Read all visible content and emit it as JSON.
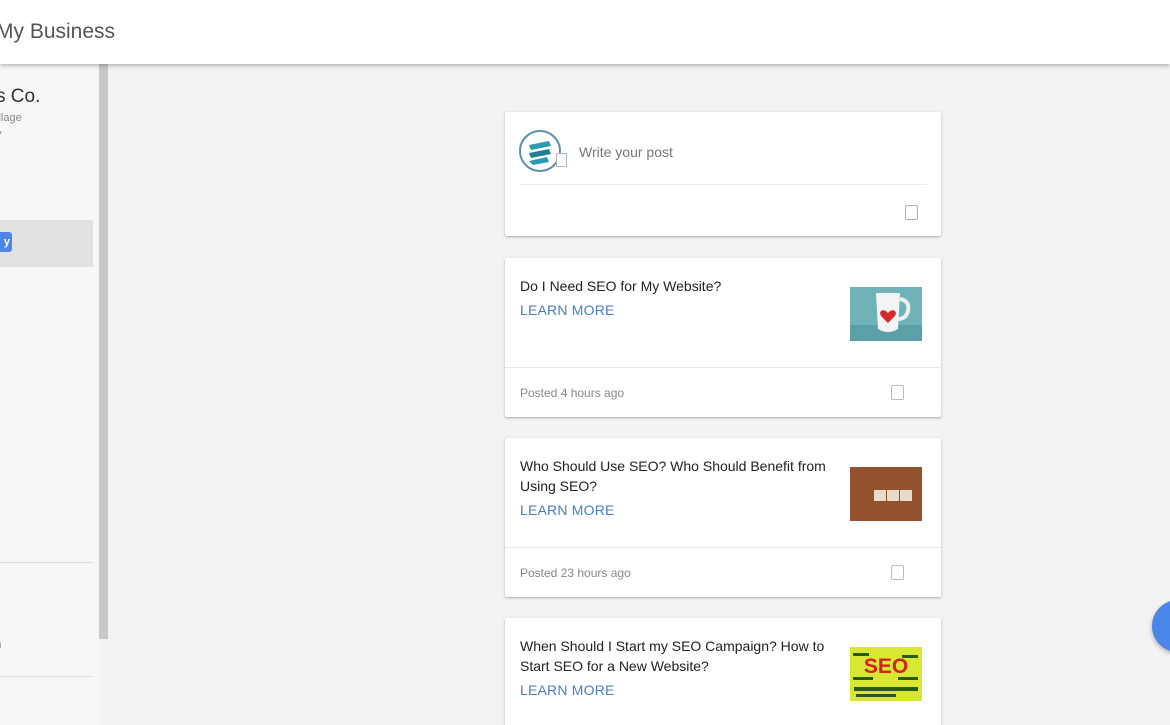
{
  "header": {
    "title": "My Business"
  },
  "sidebar": {
    "business_name": "s Co.",
    "business_line1": "illage",
    "business_line2": "y",
    "selected_badge": "y",
    "bottom_label": "n"
  },
  "composer": {
    "placeholder": "Write your post",
    "avatar_icon": "company-logo-icon",
    "action_icon": "photo-icon"
  },
  "posts": [
    {
      "title": "Do I Need SEO for My Website?",
      "cta": "LEARN MORE",
      "posted": "Posted 4 hours ago",
      "thumbnail": "mug-image",
      "menu_icon": "more-icon"
    },
    {
      "title": "Who Should Use SEO? Who Should Benefit from Using SEO?",
      "cta": "LEARN MORE",
      "posted": "Posted 23 hours ago",
      "thumbnail": "seo-tiles-image",
      "menu_icon": "more-icon"
    },
    {
      "title": "When Should I Start my SEO Campaign? How to Start SEO for a New Website?",
      "cta": "LEARN MORE",
      "thumbnail": "seo-word-cloud-image",
      "thumbnail_text": "SEO"
    }
  ],
  "fab": {
    "icon": "add-post-icon"
  },
  "colors": {
    "accent": "#4a86e8",
    "link": "#4a7fc1",
    "background": "#f3f3f3",
    "card": "#ffffff"
  }
}
